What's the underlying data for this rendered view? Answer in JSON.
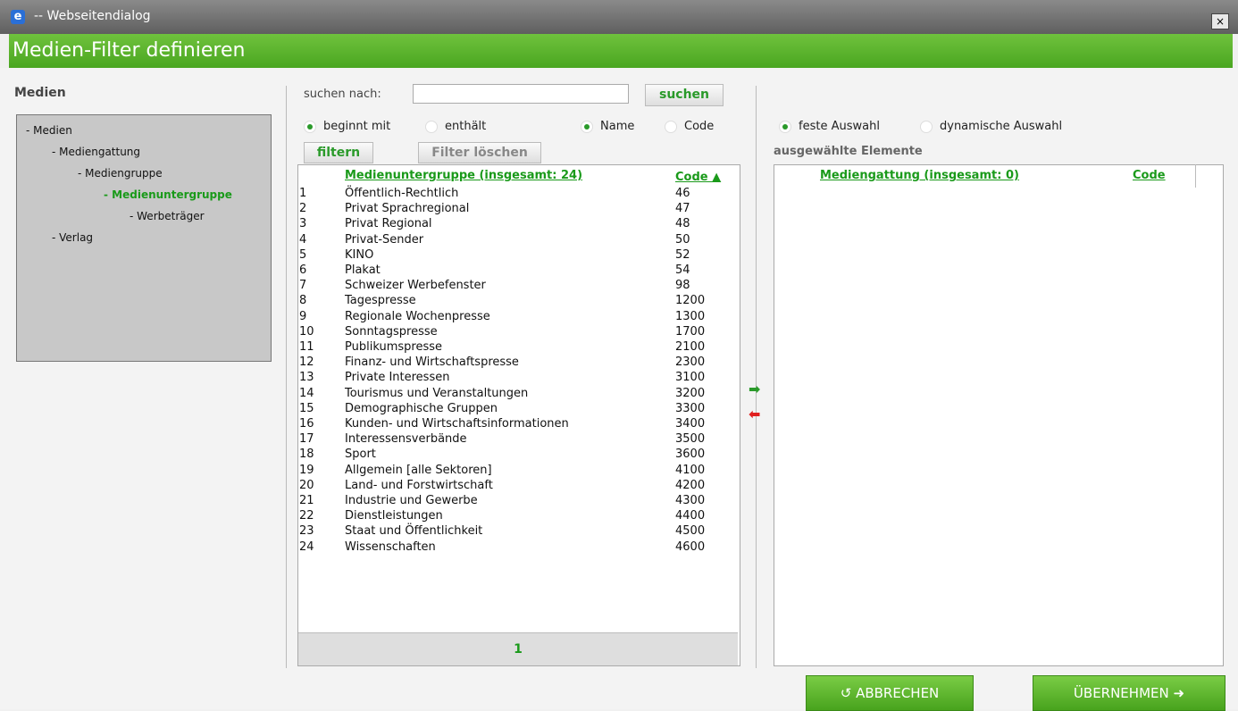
{
  "window": {
    "title": "-- Webseitendialog",
    "close": "×",
    "ie_glyph": "e"
  },
  "header": {
    "title": "Medien-Filter definieren"
  },
  "left": {
    "label": "Medien",
    "tree": [
      {
        "label": "- Medien",
        "level": 0,
        "selected": false
      },
      {
        "label": "- Mediengattung",
        "level": 1,
        "selected": false
      },
      {
        "label": "- Mediengruppe",
        "level": 2,
        "selected": false
      },
      {
        "label": "- Medienuntergruppe",
        "level": 3,
        "selected": true
      },
      {
        "label": "- Werbeträger",
        "level": 4,
        "selected": false
      },
      {
        "label": "- Verlag",
        "level": 1,
        "selected": false
      }
    ]
  },
  "search": {
    "label": "suchen nach:",
    "value": "",
    "button": "suchen",
    "opt_begins": "beginnt mit",
    "opt_contains": "enthält",
    "opt_name": "Name",
    "opt_code": "Code",
    "filter_btn": "filtern",
    "clear_btn": "Filter löschen"
  },
  "list": {
    "col_name": "Medienuntergruppe (insgesamt: 24)",
    "col_code": "Code ▲",
    "rows": [
      {
        "n": "1",
        "name": "Öffentlich-Rechtlich",
        "code": "46"
      },
      {
        "n": "2",
        "name": "Privat Sprachregional",
        "code": "47"
      },
      {
        "n": "3",
        "name": "Privat Regional",
        "code": "48"
      },
      {
        "n": "4",
        "name": "Privat-Sender",
        "code": "50"
      },
      {
        "n": "5",
        "name": "KINO",
        "code": "52"
      },
      {
        "n": "6",
        "name": "Plakat",
        "code": "54"
      },
      {
        "n": "7",
        "name": "Schweizer Werbefenster",
        "code": "98"
      },
      {
        "n": "8",
        "name": "Tagespresse",
        "code": "1200"
      },
      {
        "n": "9",
        "name": "Regionale Wochenpresse",
        "code": "1300"
      },
      {
        "n": "10",
        "name": "Sonntagspresse",
        "code": "1700"
      },
      {
        "n": "11",
        "name": "Publikumspresse",
        "code": "2100"
      },
      {
        "n": "12",
        "name": "Finanz- und Wirtschaftspresse",
        "code": "2300"
      },
      {
        "n": "13",
        "name": "Private Interessen",
        "code": "3100"
      },
      {
        "n": "14",
        "name": "Tourismus und Veranstaltungen",
        "code": "3200"
      },
      {
        "n": "15",
        "name": "Demographische Gruppen",
        "code": "3300"
      },
      {
        "n": "16",
        "name": "Kunden- und Wirtschaftsinformationen",
        "code": "3400"
      },
      {
        "n": "17",
        "name": "Interessensverbände",
        "code": "3500"
      },
      {
        "n": "18",
        "name": "Sport",
        "code": "3600"
      },
      {
        "n": "19",
        "name": "Allgemein [alle Sektoren]",
        "code": "4100"
      },
      {
        "n": "20",
        "name": "Land- und Forstwirtschaft",
        "code": "4200"
      },
      {
        "n": "21",
        "name": "Industrie und Gewerbe",
        "code": "4300"
      },
      {
        "n": "22",
        "name": "Dienstleistungen",
        "code": "4400"
      },
      {
        "n": "23",
        "name": "Staat und Öffentlichkeit",
        "code": "4500"
      },
      {
        "n": "24",
        "name": "Wissenschaften",
        "code": "4600"
      }
    ],
    "page": "1"
  },
  "arrows": {
    "add": "➡",
    "remove": "⬅",
    "add_color": "#2a9a2a",
    "remove_color": "#e02020"
  },
  "right": {
    "opt_fixed": "feste Auswahl",
    "opt_dynamic": "dynamische Auswahl",
    "selected_label": "ausgewählte Elemente",
    "col_name": "Mediengattung (insgesamt: 0)",
    "col_code": "Code"
  },
  "buttons": {
    "cancel": "ABBRECHEN",
    "cancel_icon": "↺",
    "apply": "ÜBERNEHMEN",
    "apply_icon": "➜"
  }
}
